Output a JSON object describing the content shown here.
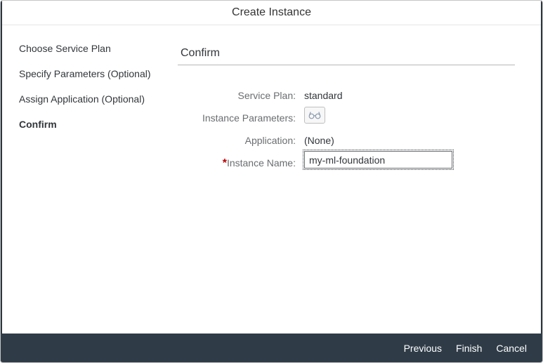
{
  "dialog": {
    "title": "Create Instance"
  },
  "steps": [
    {
      "label": "Choose Service Plan",
      "active": false
    },
    {
      "label": "Specify Parameters (Optional)",
      "active": false
    },
    {
      "label": "Assign Application (Optional)",
      "active": false
    },
    {
      "label": "Confirm",
      "active": true
    }
  ],
  "confirm": {
    "section_title": "Confirm",
    "service_plan_label": "Service Plan:",
    "service_plan_value": "standard",
    "instance_parameters_label": "Instance Parameters:",
    "instance_parameters_icon": "glasses-icon",
    "application_label": "Application:",
    "application_value": "(None)",
    "required_marker": "*",
    "instance_name_label": "Instance Name:",
    "instance_name_value": "my-ml-foundation"
  },
  "footer": {
    "previous_label": "Previous",
    "finish_label": "Finish",
    "cancel_label": "Cancel"
  },
  "colors": {
    "footer_bg": "#2f3c48",
    "required": "#bb0000"
  }
}
